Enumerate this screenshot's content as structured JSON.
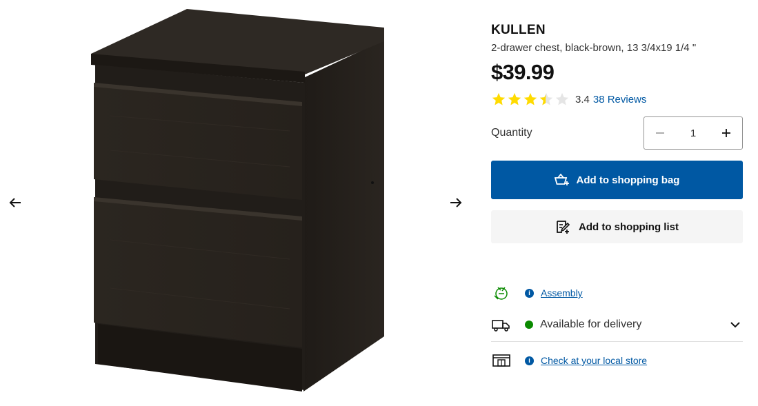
{
  "gallery": {
    "prev_icon": "arrow-left-icon",
    "next_icon": "arrow-right-icon",
    "image_alt": "KULLEN 2-drawer chest"
  },
  "product": {
    "name": "KULLEN",
    "description": "2-drawer chest, black-brown, 13 3/4x19 1/4 \"",
    "price": "$39.99",
    "rating": {
      "value": "3.4",
      "stars_out_of_5": 3.4,
      "reviews_label": "38 Reviews"
    }
  },
  "quantity": {
    "label": "Quantity",
    "value": "1",
    "decrease_icon": "minus-icon",
    "increase_icon": "plus-icon"
  },
  "actions": {
    "add_to_bag": "Add to shopping bag",
    "add_to_list": "Add to shopping list"
  },
  "info": {
    "assembly": "Assembly",
    "delivery": "Available for delivery",
    "store": "Check at your local store"
  },
  "colors": {
    "primary_blue": "#0058a3",
    "star_yellow": "#ffdb00",
    "available_green": "#0a8a00",
    "assembly_green": "#0a8a00"
  }
}
